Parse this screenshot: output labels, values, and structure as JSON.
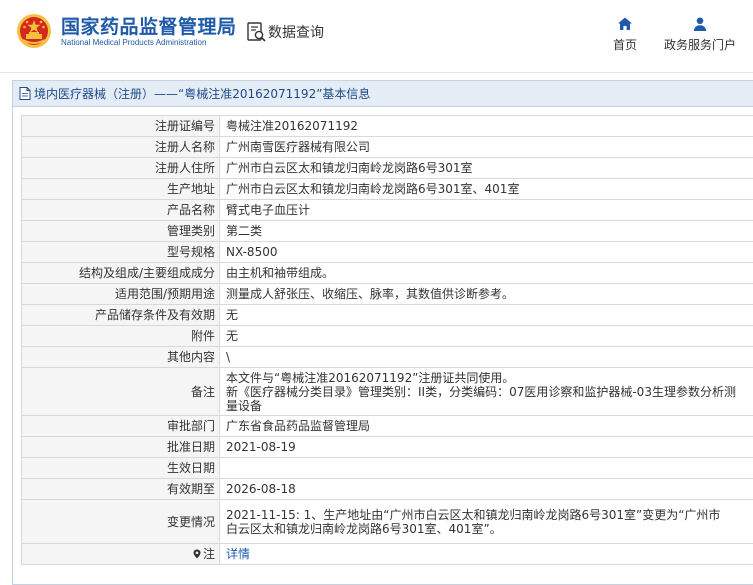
{
  "header": {
    "brand_cn": "国家药品监督管理局",
    "brand_en": "National Medical Products Administration",
    "query_label": "数据查询",
    "nav": {
      "home": "首页",
      "gov_portal": "政务服务门户"
    }
  },
  "panel": {
    "title": "境内医疗器械（注册）——“粤械注准20162071192”基本信息"
  },
  "rows": [
    {
      "label": "注册证编号",
      "value": "粤械注准20162071192"
    },
    {
      "label": "注册人名称",
      "value": "广州南雪医疗器械有限公司"
    },
    {
      "label": "注册人住所",
      "value": "广州市白云区太和镇龙归南岭龙岗路6号301室"
    },
    {
      "label": "生产地址",
      "value": "广州市白云区太和镇龙归南岭龙岗路6号301室、401室"
    },
    {
      "label": "产品名称",
      "value": "臂式电子血压计"
    },
    {
      "label": "管理类别",
      "value": "第二类"
    },
    {
      "label": "型号规格",
      "value": "NX-8500"
    },
    {
      "label": "结构及组成/主要组成成分",
      "value": "由主机和袖带组成。"
    },
    {
      "label": "适用范围/预期用途",
      "value": "测量成人舒张压、收缩压、脉率，其数值供诊断参考。"
    },
    {
      "label": "产品储存条件及有效期",
      "value": "无"
    },
    {
      "label": "附件",
      "value": "无"
    },
    {
      "label": "其他内容",
      "value": "\\"
    },
    {
      "label": "备注",
      "value_lines": [
        "本文件与“粤械注准20162071192”注册证共同使用。",
        "新《医疗器械分类目录》管理类别：II类，分类编码：07医用诊察和监护器械-03生理参数分析测",
        "量设备"
      ]
    },
    {
      "label": "审批部门",
      "value": "广东省食品药品监督管理局"
    },
    {
      "label": "批准日期",
      "value": "2021-08-19"
    },
    {
      "label": "生效日期",
      "value": ""
    },
    {
      "label": "有效期至",
      "value": "2026-08-18"
    },
    {
      "label": "变更情况",
      "value_lines": [
        "2021-11-15: 1、生产地址由“广州市白云区太和镇龙归南岭龙岗路6号301室”变更为“广州市",
        "白云区太和镇龙归南岭龙岗路6号301室、401室”。"
      ]
    },
    {
      "label": "注",
      "value": "详情"
    }
  ],
  "colors": {
    "brand_blue": "#1f5ba8",
    "title_bar": "#e4ecf5",
    "label_bg": "#f5f5f5",
    "emblem_red": "#d7261c",
    "emblem_gold": "#f3c042"
  }
}
